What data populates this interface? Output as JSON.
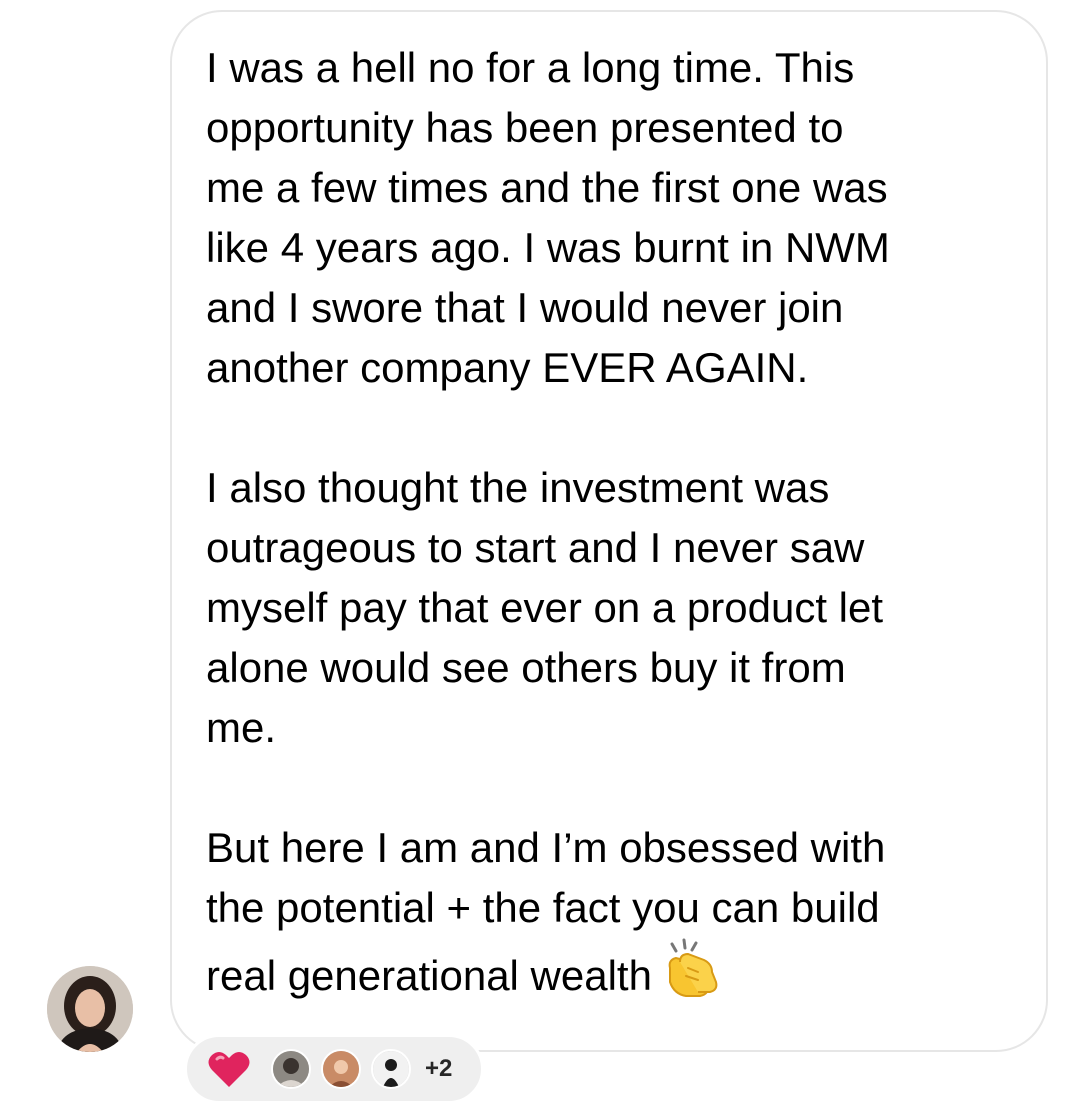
{
  "message": {
    "paragraphs": [
      "I was a hell no for a long time. This\nopportunity has been presented to\nme a few times and the first one was\nlike 4 years ago. I was burnt in NWM\nand I swore that I would never join\nanother company EVER AGAIN.",
      "I also thought the investment was\noutrageous to start and I never saw\nmyself pay that ever on a product let\nalone would see others buy it from\nme.",
      "But here I am and I’m obsessed with\nthe potential + the fact you can build\nreal generational wealth"
    ],
    "trailing_emoji": "clapping-hands-icon"
  },
  "reactions": {
    "emoji": "red-heart-icon",
    "reactor_avatars": [
      "reactor-avatar-1",
      "reactor-avatar-2",
      "reactor-avatar-3"
    ],
    "more_count": "+2"
  },
  "colors": {
    "bubble_border": "#e6e6e6",
    "reaction_pill": "#efefef",
    "heart": "#e0245e",
    "text": "#000000"
  }
}
